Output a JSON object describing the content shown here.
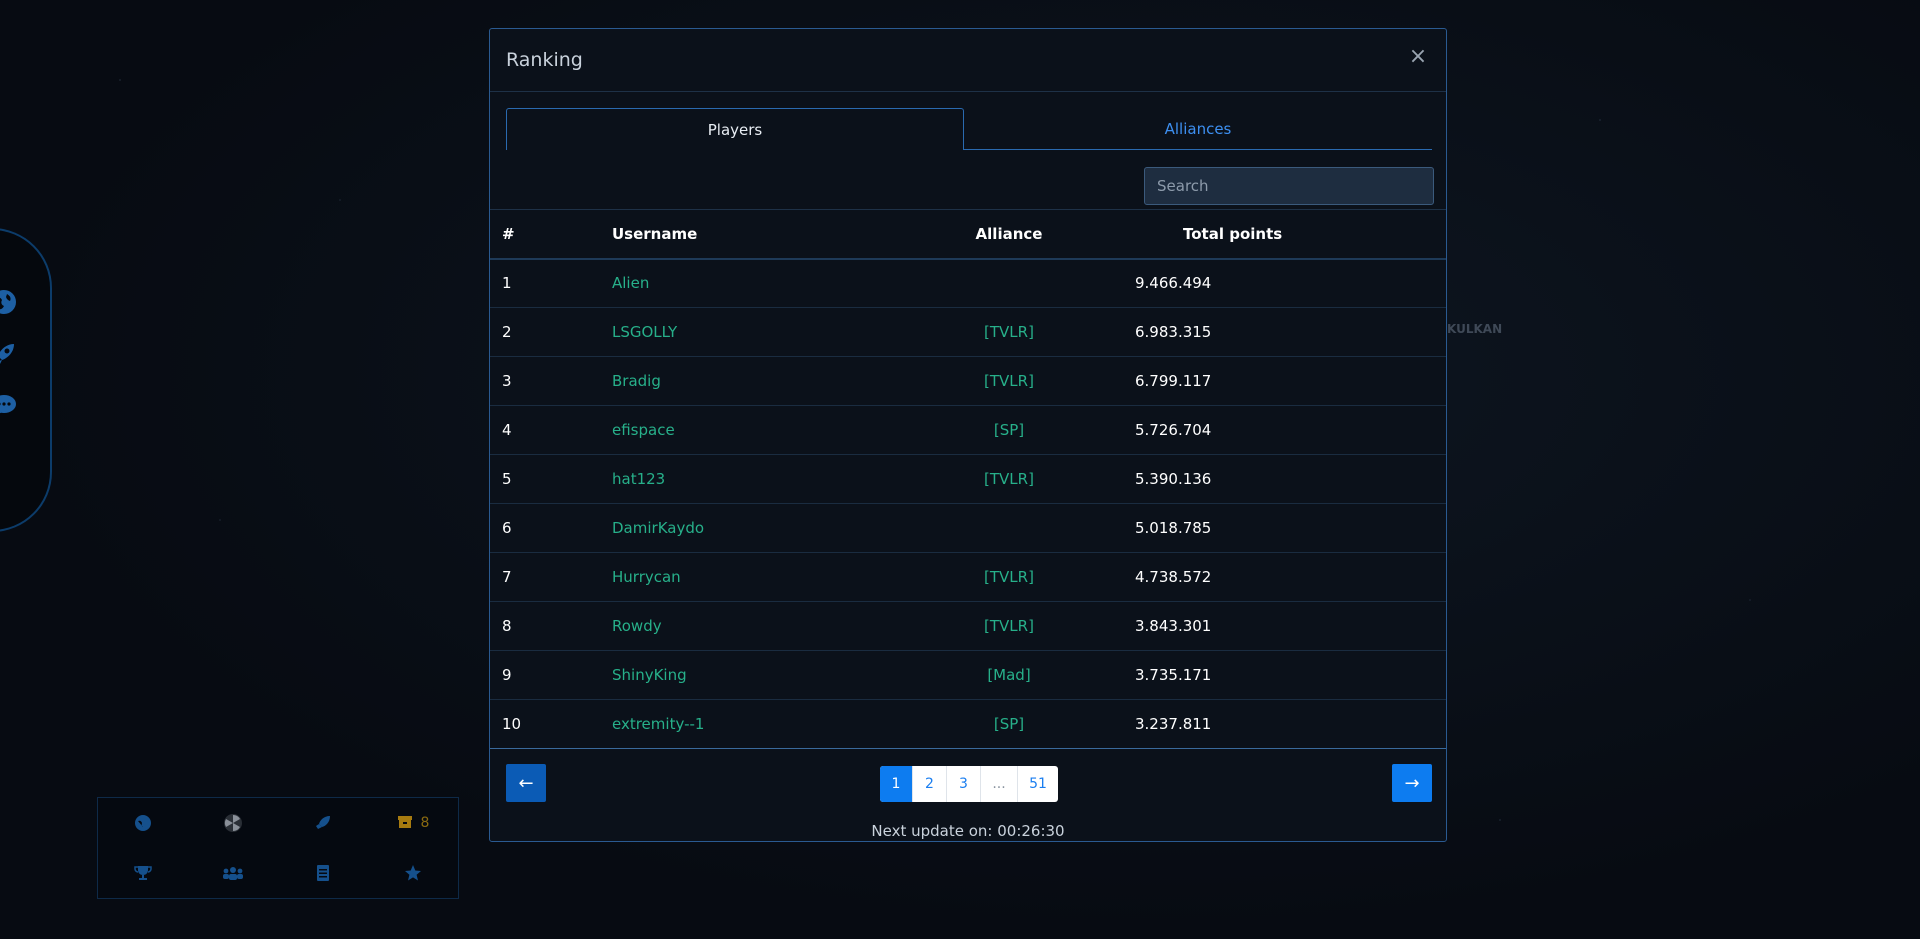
{
  "background": {
    "labels": [
      "KULKAN"
    ]
  },
  "side_panel": {
    "icons": [
      "globe-icon",
      "rocket-icon",
      "chat-icon"
    ]
  },
  "quickbar": {
    "row1": [
      "globe-icon",
      "radiation-icon",
      "rocket-icon",
      "crate-icon"
    ],
    "crate_count": "8",
    "row2": [
      "trophy-icon",
      "users-icon",
      "document-icon",
      "star-icon"
    ]
  },
  "modal": {
    "title": "Ranking",
    "close_symbol": "×",
    "tabs": {
      "players": "Players",
      "alliances": "Alliances"
    },
    "search": {
      "placeholder": "Search",
      "value": ""
    },
    "columns": {
      "rank": "#",
      "username": "Username",
      "alliance": "Alliance",
      "points": "Total points"
    },
    "rows": [
      {
        "rank": "1",
        "username": "Alien",
        "alliance": "",
        "points": "9.466.494"
      },
      {
        "rank": "2",
        "username": "LSGOLLY",
        "alliance": "[TVLR]",
        "points": "6.983.315"
      },
      {
        "rank": "3",
        "username": "Bradig",
        "alliance": "[TVLR]",
        "points": "6.799.117"
      },
      {
        "rank": "4",
        "username": "efispace",
        "alliance": "[SP]",
        "points": "5.726.704"
      },
      {
        "rank": "5",
        "username": "hat123",
        "alliance": "[TVLR]",
        "points": "5.390.136"
      },
      {
        "rank": "6",
        "username": "DamirKaydo",
        "alliance": "",
        "points": "5.018.785"
      },
      {
        "rank": "7",
        "username": "Hurrycan",
        "alliance": "[TVLR]",
        "points": "4.738.572"
      },
      {
        "rank": "8",
        "username": "Rowdy",
        "alliance": "[TVLR]",
        "points": "3.843.301"
      },
      {
        "rank": "9",
        "username": "ShinyKing",
        "alliance": "[Mad]",
        "points": "3.735.171"
      },
      {
        "rank": "10",
        "username": "extremity--1",
        "alliance": "[SP]",
        "points": "3.237.811"
      }
    ],
    "pagination": {
      "prev_symbol": "←",
      "next_symbol": "→",
      "pages": [
        "1",
        "2",
        "3",
        "...",
        "51"
      ],
      "active": "1"
    },
    "next_update": "Next update on: 00:26:30"
  },
  "colors": {
    "accent": "#0d7cf0",
    "link": "#27b08a",
    "modal_bg": "#0b111a",
    "border": "#2a5a91"
  }
}
